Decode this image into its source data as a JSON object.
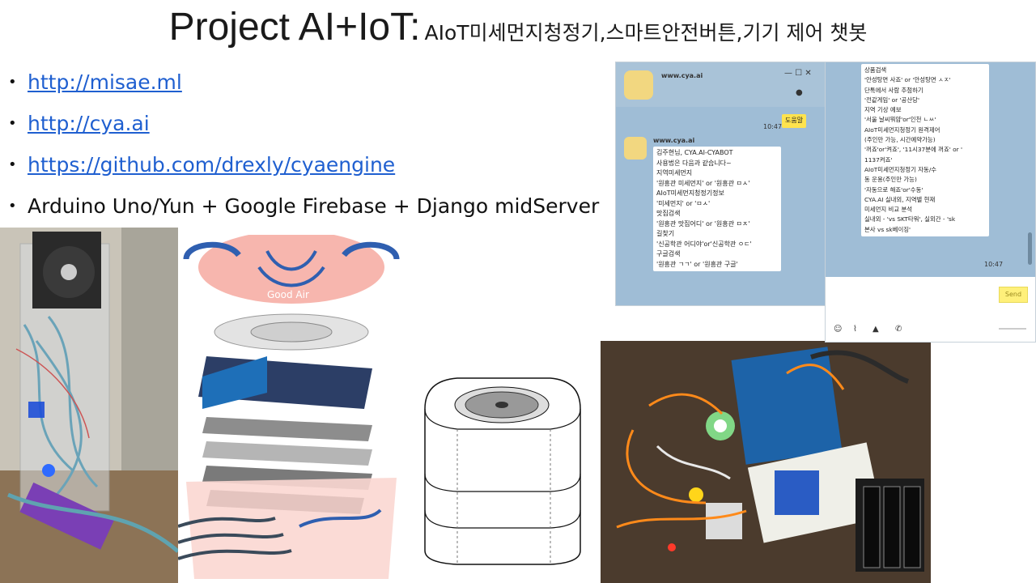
{
  "slide": {
    "title_main": "Project AI+IoT:",
    "title_sub": "AIoT미세먼지청정기,스마트안전버튼,기기 제어 챗봇",
    "bullets": [
      {
        "text": "http://misae.ml",
        "is_link": true
      },
      {
        "text": "http://cya.ai",
        "is_link": true
      },
      {
        "text": "https://github.com/drexly/cyaengine",
        "is_link": true
      },
      {
        "text": "Arduino Uno/Yun + Google Firebase + Django midServer",
        "is_link": false
      }
    ]
  },
  "chat": {
    "window_title": "www.cya.ai",
    "time_top": "10:47",
    "user_message": "도움말",
    "sender_name": "www.cya.ai",
    "left_lines": [
      "김주현님, CYA.AI-CYABOT",
      "사용법은 다음과 같습니다~",
      "지역미세먼지",
      "'원흥관 미세먼지' or '원흥관 ㅁㅅ'",
      "AIoT미세먼지청정기정보",
      "'미세먼지' or 'ㅁㅅ'",
      "맛집검색",
      "'원흥관 맛집어디' or '원흥관 ㅁㅈ'",
      "길찾기",
      "'신공학관 어디야'or'신공학관 ㅇㄷ'",
      "구글검색",
      "'원흥관 ㄱㄱ' or '원흥관 구글'"
    ],
    "right_lines": [
      "상품검색",
      "'안성탕면 사죠' or '안성탕면 ㅅㅈ'",
      "단톡에서 사람 추첨하기",
      "'전같게임' or '공산당'",
      "지역 기상 예보",
      "'서울 날씨뭐얌'or'인천 ㄴㅆ'",
      "AIoT미세먼지청정기 원격제어",
      "(주인만 가능, 시간예약가능)",
      "'꺼죠'or'켜죠', '11시37분에 꺼죠' or '",
      "1137켜죠'",
      "AIoT미세먼지청정기 자동/수",
      "동 운용(주인만 가능)",
      "'자동으로 해죠'or'수동'",
      "CYA.AI 실내외, 지역별 현재",
      "미세먼지 비교 분석",
      "실내외 - 'vs SKT타워', 실외간 - 'sk",
      "본사 vs sk베이징'"
    ],
    "time_bottom": "10:47",
    "send_label": "Send"
  },
  "graphic": {
    "filter_brand": "Good Air"
  },
  "colors": {
    "link": "#1f5fd0",
    "chat_bg": "#9fbdd6",
    "send_button": "#fff07a"
  }
}
